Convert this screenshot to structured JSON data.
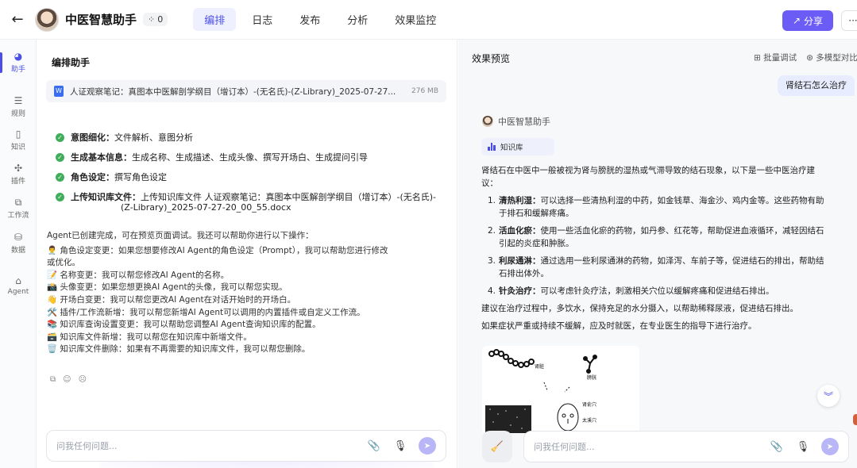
{
  "header": {
    "back_icon": "arrow-left-icon",
    "title": "中医智慧助手",
    "team_count": "0",
    "tabs": [
      {
        "label": "编排",
        "active": true
      },
      {
        "label": "日志"
      },
      {
        "label": "发布"
      },
      {
        "label": "分析"
      },
      {
        "label": "效果监控"
      }
    ],
    "share_label": "分享",
    "more_label": "···",
    "accent": "#6c5cf6"
  },
  "rail": {
    "items": [
      {
        "label": "助手",
        "icon": "assistant-icon"
      },
      {
        "label": "规则",
        "icon": "rules-icon"
      },
      {
        "label": "知识",
        "icon": "knowledge-icon"
      },
      {
        "label": "插件",
        "icon": "plugin-icon"
      },
      {
        "label": "工作流",
        "icon": "workflow-icon"
      },
      {
        "label": "数据",
        "icon": "database-icon"
      },
      {
        "label": "Agent",
        "icon": "agent-icon"
      }
    ]
  },
  "left": {
    "title": "编排助手",
    "file": {
      "name": "人证观察笔记：真图本中医解剖学纲目（增订本）-(无名氏)-(Z-Library)_2025-07-27...",
      "size": "276 MB"
    },
    "checklist": [
      {
        "key": "意图细化：",
        "value": "文件解析、意图分析"
      },
      {
        "key": "生成基本信息：",
        "value": "生成名称、生成描述、生成头像、撰写开场白、生成提问引导"
      },
      {
        "key": "角色设定：",
        "value": "撰写角色设定"
      },
      {
        "key": "上传知识库文件：",
        "value": "上传知识库文件 人证观察笔记：真图本中医解剖学纲目（增订本）-(无名氏)-"
      },
      {
        "key": "",
        "value": "(Z-Library)_2025-07-27-20_00_55.docx"
      }
    ],
    "message": [
      "Agent已创建完成，可在预览页面调试。我还可以帮助你进行以下操作：",
      "👨‍⚕️ 角色设定变更：如果您想要修改AI Agent的角色设定（Prompt），我可以帮助您进行修改",
      "或优化。",
      "📝 名称变更：我可以帮您修改AI Agent的名称。",
      "📸 头像变更：如果您想更换AI Agent的头像，我可以帮您实现。",
      "👋 开场白变更：我可以帮您更改AI Agent在对话开始时的开场白。",
      "🛠️ 插件/工作流新增：我可以帮您新增AI Agent可以调用的内置插件或自定义工作流。",
      "📚 知识库查询设置变更：我可以帮助您调整AI Agent查询知识库的配置。",
      "🗃️ 知识库文件新增：我可以帮您在知识库中新增文件。",
      "🗑️ 知识库文件删除：如果有不再需要的知识库文件，我可以帮您删除。"
    ],
    "input_placeholder": "问我任何问题..."
  },
  "right": {
    "title": "效果预览",
    "batch_debug": "批量调试",
    "multi_model": "多模型对比",
    "user_question": "肾结石怎么治疗",
    "bot_name": "中医智慧助手",
    "kb_label": "知识库",
    "answer_intro_1": "肾结石在中医中一般被视为肾与膀胱的湿热或气滞导致的结石现象，以下是一些中医治疗建",
    "answer_intro_2": "议：",
    "steps": [
      {
        "num": "1.",
        "key": "清热利湿：",
        "value": "可以选择一些清热利湿的中药，如金钱草、海金沙、鸡内金等。这些药物有助于排石和缓解疼痛。"
      },
      {
        "num": "2.",
        "key": "活血化瘀：",
        "value": "使用一些活血化瘀的药物，如丹参、红花等，帮助促进血液循环，减轻因结石引起的炎症和肿胀。"
      },
      {
        "num": "3.",
        "key": "利尿通淋：",
        "value": "通过选用一些利尿通淋的药物，如泽泻、车前子等，促进结石的排出，帮助结石排出体外。"
      },
      {
        "num": "4.",
        "key": "针灸治疗：",
        "value": "可以考虑针灸疗法，刺激相关穴位以缓解疼痛和促进结石排出。"
      }
    ],
    "advice_1": "建议在治疗过程中，多饮水，保持充足的水分摄入，以帮助稀释尿液，促进结石排出。",
    "advice_2": "如果症状严重或持续不缓解，应及时就医，在专业医生的指导下进行治疗。",
    "diagram_labels": [
      "肾脏",
      "膀胱",
      "肾俞穴",
      "太溪穴"
    ],
    "input_placeholder": "问我任何问题..."
  }
}
